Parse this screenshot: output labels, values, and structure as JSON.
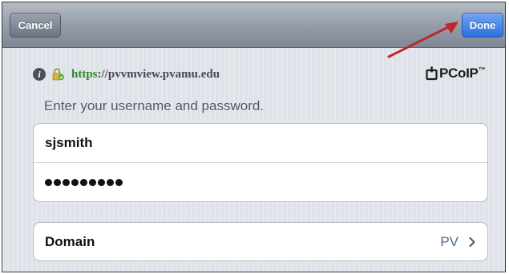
{
  "navbar": {
    "cancel_label": "Cancel",
    "done_label": "Done"
  },
  "server": {
    "info_icon": "info-icon",
    "lock_icon": "lock-icon",
    "url_scheme": "https",
    "url_rest": "://pvvmview.pvamu.edu",
    "brand": "PCoIP",
    "brand_mark": "™",
    "brand_icon": "pcoip-logo-icon"
  },
  "login": {
    "prompt": "Enter your username and password.",
    "username": "sjsmith",
    "password_dot_count": 9
  },
  "domain": {
    "label": "Domain",
    "value": "PV",
    "chevron_icon": "chevron-right-icon"
  },
  "annotation": {
    "arrow_icon": "red-arrow-icon",
    "arrow_color": "#c0262c"
  },
  "colors": {
    "done_button": "#2e6fe0",
    "url_scheme": "#2a8a2a",
    "prompt_text": "#4b5668",
    "domain_value": "#4d6b95"
  }
}
